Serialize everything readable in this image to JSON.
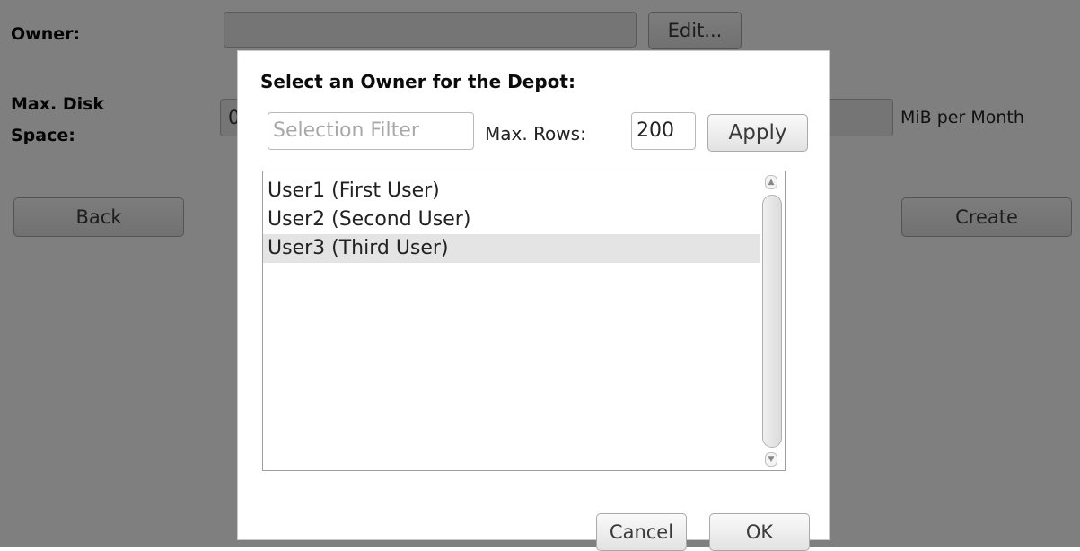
{
  "form": {
    "owner_label": "Owner:",
    "owner_value": "",
    "edit_button": "Edit...",
    "disk_label_line1": "Max. Disk",
    "disk_label_line2": "Space:",
    "disk_value": "0",
    "disk_unit": "MiB per Month",
    "back_button": "Back",
    "create_button": "Create"
  },
  "dialog": {
    "title": "Select an Owner for the Depot:",
    "filter_placeholder": "Selection Filter",
    "filter_value": "",
    "max_rows_label": "Max. Rows:",
    "max_rows_value": "200",
    "apply_button": "Apply",
    "items": [
      {
        "label": "User1 (First User)",
        "selected": false
      },
      {
        "label": "User2 (Second User)",
        "selected": false
      },
      {
        "label": "User3 (Third User)",
        "selected": true
      }
    ],
    "cancel_button": "Cancel",
    "ok_button": "OK"
  },
  "icons": {
    "scroll_up": "chevron-up-icon",
    "scroll_down": "chevron-down-icon"
  },
  "colors": {
    "overlay": "#808080",
    "selection": "#e4e4e4"
  }
}
